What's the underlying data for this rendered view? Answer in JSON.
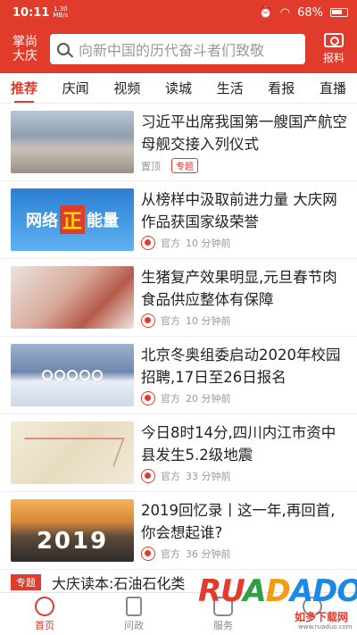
{
  "status_bar": {
    "time": "10:11",
    "net_speed": "1.30",
    "net_unit": "MB/s",
    "battery": "68%"
  },
  "header": {
    "city": "掌尚大庆",
    "search_placeholder": "向新中国的历代奋斗者们致敬",
    "report_label": "报料"
  },
  "tabs": [
    {
      "label": "推荐"
    },
    {
      "label": "庆闻"
    },
    {
      "label": "视频"
    },
    {
      "label": "读城"
    },
    {
      "label": "生活"
    },
    {
      "label": "看报"
    },
    {
      "label": "直播"
    }
  ],
  "feed": [
    {
      "title": "习近平出席我国第一艘国产航空母舰交接入列仪式",
      "source": "置顶",
      "tag": "专题",
      "time": ""
    },
    {
      "title": "从榜样中汲取前进力量 大庆网作品获国家级荣誉",
      "source": "官方",
      "time": "10 分钟前",
      "thumb_text_a": "网络",
      "thumb_text_b": "正",
      "thumb_text_c": "能量"
    },
    {
      "title": "生猪复产效果明显,元旦春节肉食品供应整体有保障",
      "source": "官方",
      "time": "10 分钟前"
    },
    {
      "title": "北京冬奥组委启动2020年校园招聘,17日至26日报名",
      "source": "官方",
      "time": "20 分钟前"
    },
    {
      "title": "今日8时14分,四川内江市资中县发生5.2级地震",
      "source": "官方",
      "time": "33 分钟前"
    },
    {
      "title": "2019回忆录丨这一年,再回首,你会想起谁?",
      "source": "官方",
      "time": "36 分钟前",
      "thumb_text": "2019"
    }
  ],
  "partial_item": {
    "tag": "专题",
    "title": "大庆读本:石油石化类"
  },
  "bottom_nav": [
    {
      "label": "首页"
    },
    {
      "label": "问政"
    },
    {
      "label": "服务"
    },
    {
      "label": ""
    }
  ],
  "watermark": {
    "brand": "RUANDADO",
    "cn": "如多下载网",
    "url": "www.ruaduo.com"
  },
  "colors": {
    "accent": "#e13b2c"
  }
}
